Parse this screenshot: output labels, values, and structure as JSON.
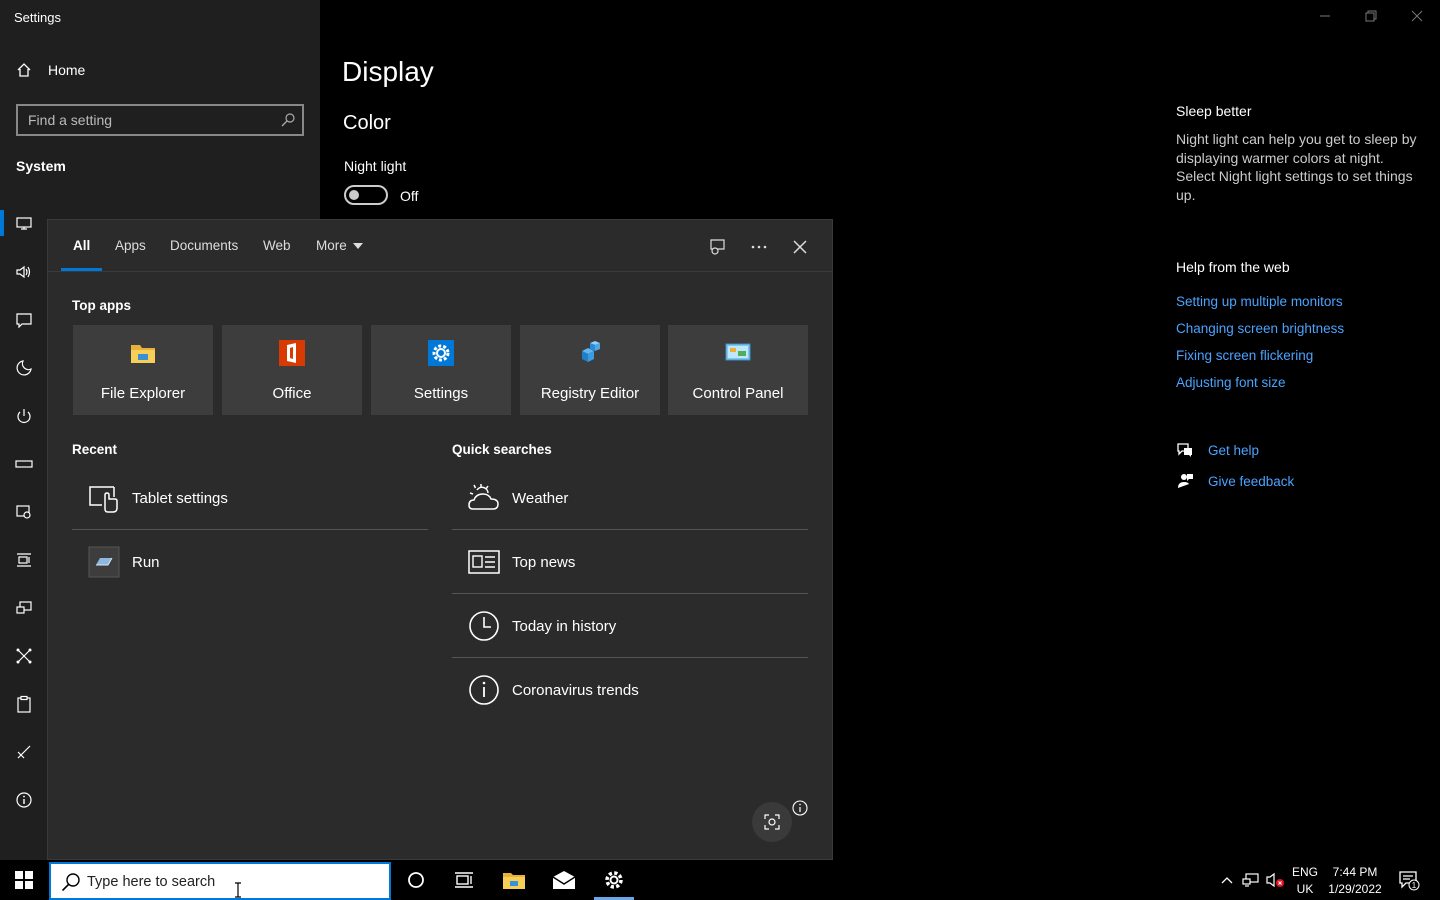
{
  "window": {
    "title": "Settings",
    "controls": {
      "minimize": "minimize-icon",
      "restore": "restore-icon",
      "close": "close-icon"
    }
  },
  "sidebar": {
    "home_label": "Home",
    "search_placeholder": "Find a setting",
    "section_label": "System",
    "nav_icons": [
      "display-icon",
      "sound-icon",
      "notifications-icon",
      "focus-assist-icon",
      "power-icon",
      "storage-icon",
      "tablet-icon",
      "multitasking-icon",
      "projecting-icon",
      "shared-experiences-icon",
      "clipboard-icon",
      "remote-desktop-icon",
      "about-icon"
    ]
  },
  "main": {
    "page_title": "Display",
    "section_title": "Color",
    "night_light_label": "Night light",
    "night_light_state": "Off"
  },
  "right_panel": {
    "sleep_title": "Sleep better",
    "sleep_desc": "Night light can help you get to sleep by displaying warmer colors at night. Select Night light settings to set things up.",
    "help_title": "Help from the web",
    "links": [
      "Setting up multiple monitors",
      "Changing screen brightness",
      "Fixing screen flickering",
      "Adjusting font size"
    ],
    "get_help": "Get help",
    "give_feedback": "Give feedback"
  },
  "search_panel": {
    "tabs": [
      "All",
      "Apps",
      "Documents",
      "Web",
      "More"
    ],
    "active_tab": "All",
    "top_apps_label": "Top apps",
    "top_apps": [
      {
        "label": "File Explorer",
        "icon": "file-explorer-icon"
      },
      {
        "label": "Office",
        "icon": "office-icon"
      },
      {
        "label": "Settings",
        "icon": "settings-gear-icon"
      },
      {
        "label": "Registry Editor",
        "icon": "registry-editor-icon"
      },
      {
        "label": "Control Panel",
        "icon": "control-panel-icon"
      }
    ],
    "recent_label": "Recent",
    "recent": [
      {
        "label": "Tablet settings",
        "icon": "tablet-settings-icon"
      },
      {
        "label": "Run",
        "icon": "run-icon"
      }
    ],
    "quick_label": "Quick searches",
    "quick": [
      {
        "label": "Weather",
        "icon": "weather-icon"
      },
      {
        "label": "Top news",
        "icon": "news-icon"
      },
      {
        "label": "Today in history",
        "icon": "clock-icon"
      },
      {
        "label": "Coronavirus trends",
        "icon": "info-icon"
      }
    ]
  },
  "taskbar": {
    "search_placeholder": "Type here to search",
    "lang_line1": "ENG",
    "lang_line2": "UK",
    "time": "7:44 PM",
    "date": "1/29/2022",
    "notification_count": "1",
    "accent": "#0078d7"
  }
}
